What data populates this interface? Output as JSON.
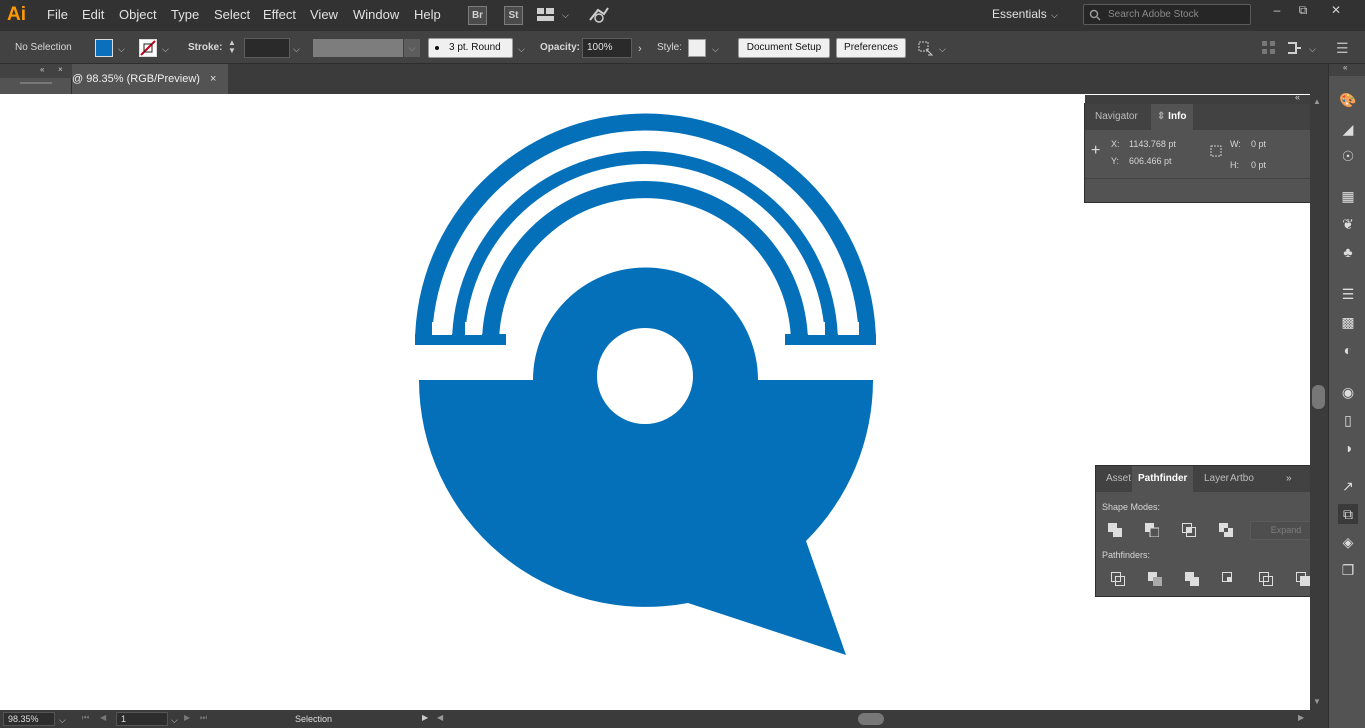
{
  "app": {
    "logo": "Ai",
    "menu": [
      "File",
      "Edit",
      "Object",
      "Type",
      "Select",
      "Effect",
      "View",
      "Window",
      "Help"
    ],
    "bridge_btn": "Br",
    "stock_btn": "St",
    "workspace": "Essentials",
    "search_placeholder": "Search Adobe Stock"
  },
  "control_bar": {
    "selection_label": "No Selection",
    "stroke_label": "Stroke:",
    "brush_label": "3 pt. Round",
    "opacity_label": "Opacity:",
    "opacity_value": "100%",
    "style_label": "Style:",
    "document_setup": "Document Setup",
    "preferences": "Preferences"
  },
  "document": {
    "tab_title": "@ 98.35% (RGB/Preview)",
    "close_glyph": "×"
  },
  "colors": {
    "fill": "#0a70bc",
    "logo_blue": "#0470ba"
  },
  "info_panel": {
    "tabs": [
      "Navigator",
      "Info"
    ],
    "x_label": "X:",
    "x_value": "1143.768 pt",
    "y_label": "Y:",
    "y_value": "606.466 pt",
    "w_label": "W:",
    "w_value": "0 pt",
    "h_label": "H:",
    "h_value": "0 pt"
  },
  "pathfinder_panel": {
    "tabs": [
      "Asset",
      "Pathfinder",
      "Layer",
      "Artbo"
    ],
    "shape_modes_label": "Shape Modes:",
    "expand_label": "Expand",
    "pathfinders_label": "Pathfinders:"
  },
  "status_bar": {
    "zoom": "98.35%",
    "artboard": "1",
    "tool": "Selection"
  }
}
